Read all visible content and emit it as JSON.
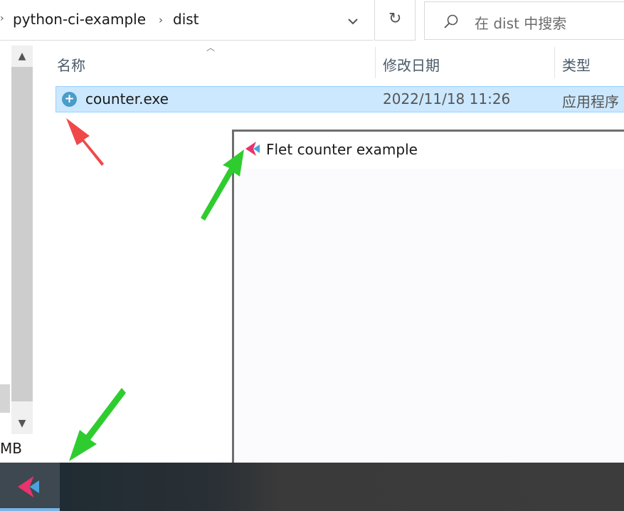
{
  "breadcrumb": {
    "segments": [
      "python-ci-example",
      "dist"
    ]
  },
  "search": {
    "placeholder": "在 dist 中搜索"
  },
  "columns": {
    "name": "名称",
    "date": "修改日期",
    "type": "类型"
  },
  "files": [
    {
      "name": "counter.exe",
      "date": "2022/11/18 11:26",
      "type": "应用程序"
    }
  ],
  "status": {
    "size_fragment": "MB"
  },
  "app_window": {
    "title": "Flet counter example"
  },
  "icons": {
    "exe": "exe-plus-icon",
    "app": "flet-logo-icon",
    "search": "search-icon",
    "refresh": "refresh-icon",
    "dropdown": "chevron-down-icon"
  },
  "colors": {
    "selection": "#cce8ff",
    "selection_border": "#99d1ff",
    "flet_pink": "#e8336b",
    "flet_blue": "#4aa3df",
    "arrow_red": "#f04848",
    "arrow_green": "#2fcc2f",
    "taskbar_accent": "#78b4e6"
  }
}
